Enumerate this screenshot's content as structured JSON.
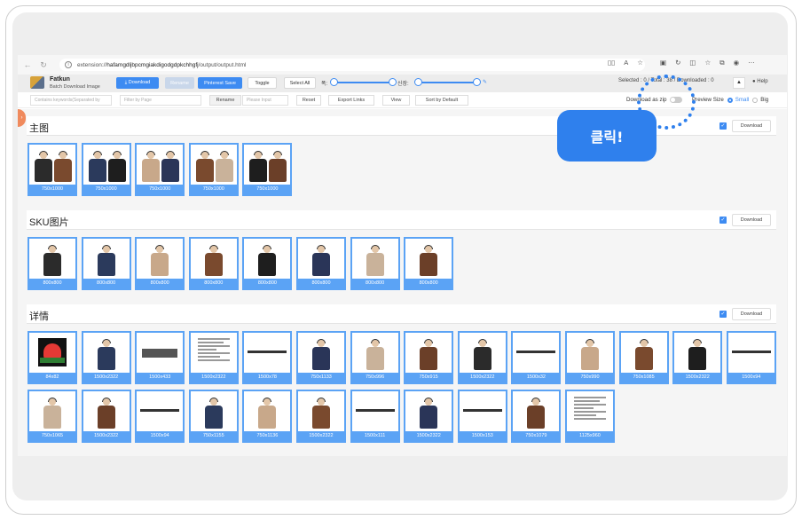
{
  "browser": {
    "url_prefix": "extension://",
    "url_host": "hafamgdljbpcmgiakdigodgdpkchhgfj",
    "url_path": "/output/output.html",
    "right_icons": [
      "tab-icon",
      "read-aloud-icon",
      "star-icon",
      "extension-icon",
      "refresh-icon",
      "split-icon",
      "favorites-icon",
      "collections-icon",
      "profile-icon",
      "more-icon"
    ]
  },
  "header": {
    "brand_title": "Fatkun",
    "brand_subtitle": "Batch Download Image",
    "download_label": "⤓ Download",
    "rename_top_label": "Rename",
    "pinterest_label": "Pinterest Save",
    "toggle_label": "Toggle",
    "select_all_label": "Select All",
    "width_label": "폭:",
    "height_label": "신장:",
    "selected_label": "Selected : 0 / Total : 38 / Downloaded : 0",
    "help_label": "Help"
  },
  "toolbar": {
    "keywords_placeholder": "Contains keywords(Separated by",
    "filter_placeholder": "Filter by Page",
    "rename_label": "Rename",
    "please_input_placeholder": "Please Input",
    "reset_label": "Reset",
    "export_label": "Export Links",
    "view_label": "View",
    "sort_label": "Sort by Default",
    "download_zip_label": "Download as zip",
    "preview_size_label": "Preview Size",
    "small_label": "Small",
    "big_label": "Big"
  },
  "callout": {
    "text": "클릭!"
  },
  "sections": [
    {
      "title": "主图",
      "download_label": "Download",
      "items": [
        "750x1000",
        "750x1000",
        "750x1000",
        "750x1000",
        "750x1000"
      ]
    },
    {
      "title": "SKU图片",
      "download_label": "Download",
      "items": [
        "800x800",
        "800x800",
        "800x800",
        "800x800",
        "800x800",
        "800x800",
        "800x800",
        "800x800"
      ]
    },
    {
      "title": "详情",
      "download_label": "Download",
      "items": [
        "84x82",
        "1500x2322",
        "1500x433",
        "1500x2322",
        "1500x78",
        "750x1133",
        "750x996",
        "750x915",
        "1500x2322",
        "1500x32",
        "750x990",
        "750x1085",
        "1500x2322",
        "1500x94",
        "750x1065",
        "1500x2322",
        "1500x94",
        "750x1155",
        "750x1136",
        "1500x2322",
        "1500x111",
        "1500x2322",
        "1500x153",
        "750x1079",
        "1125x960"
      ]
    }
  ],
  "colors": {
    "accent": "#3d8bf2",
    "thumb_border": "#5ba3f5",
    "callout": "#2f80ed",
    "side_tab": "#f08a5d"
  }
}
